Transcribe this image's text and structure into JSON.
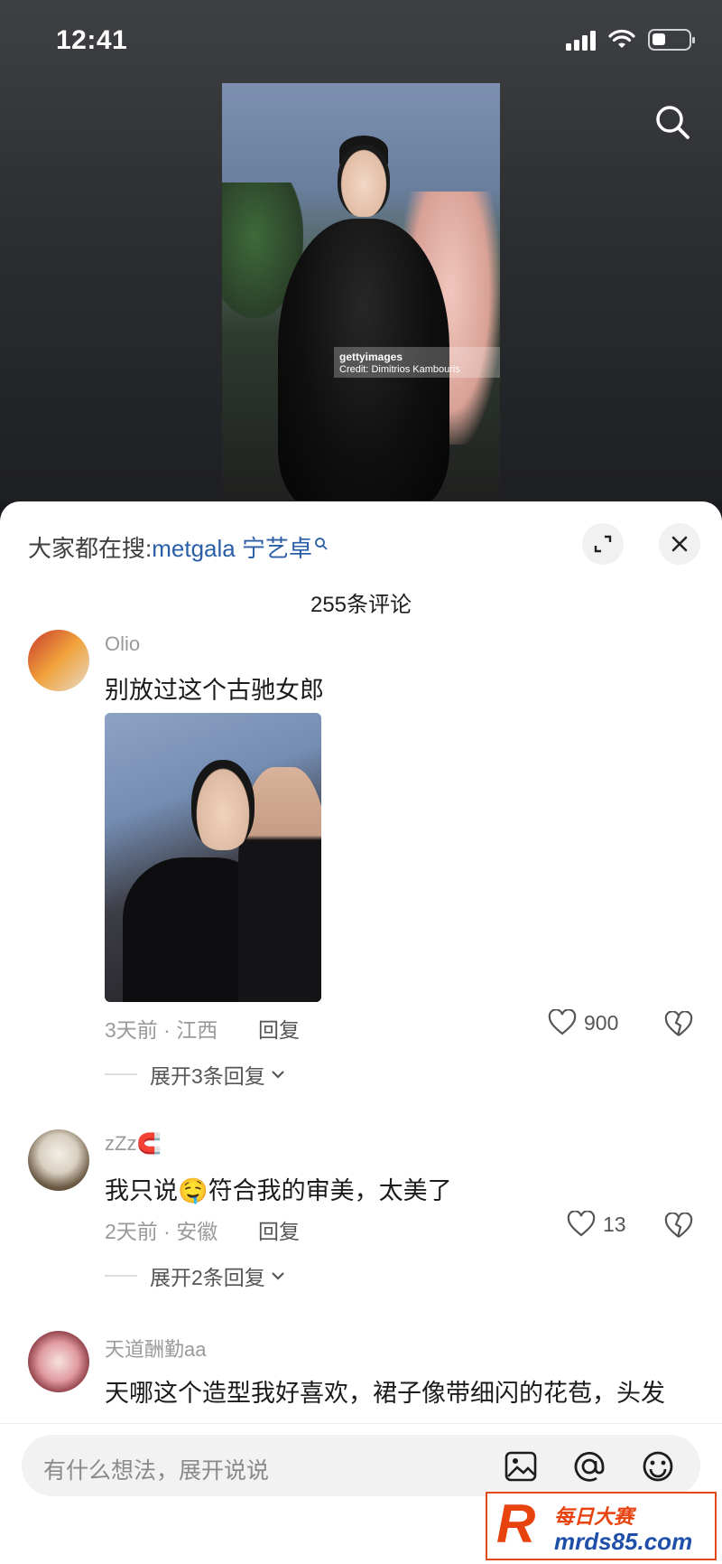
{
  "status_bar": {
    "time": "12:41"
  },
  "hero": {
    "watermark_brand": "gettyimages",
    "watermark_credit": "Credit: Dimitrios Kambouris"
  },
  "sheet": {
    "trending_prefix": "大家都在搜:",
    "trending_keyword": "metgala 宁艺卓",
    "comment_count": "255条评论"
  },
  "comments": [
    {
      "username": "Olio",
      "text": "别放过这个古驰女郎",
      "time_location": "3天前 · 江西",
      "reply_label": "回复",
      "likes": "900",
      "expand_label": "展开3条回复"
    },
    {
      "username": "zZz🧲",
      "text": "我只说🤤符合我的审美，太美了",
      "time_location": "2天前 · 安徽",
      "reply_label": "回复",
      "likes": "13",
      "expand_label": "展开2条回复"
    },
    {
      "username": "天道酬勤aa",
      "text": "天哪这个造型我好喜欢，裙子像带细闪的花苞，头发"
    }
  ],
  "composer": {
    "placeholder": "有什么想法，展开说说"
  },
  "watermark_logo": {
    "letter": "R",
    "cn": "每日大赛",
    "url": "mrds85.com"
  },
  "colors": {
    "keyword_blue": "#2a5fa8",
    "logo_orange": "#e8420f",
    "logo_blue": "#1f4fa8"
  }
}
